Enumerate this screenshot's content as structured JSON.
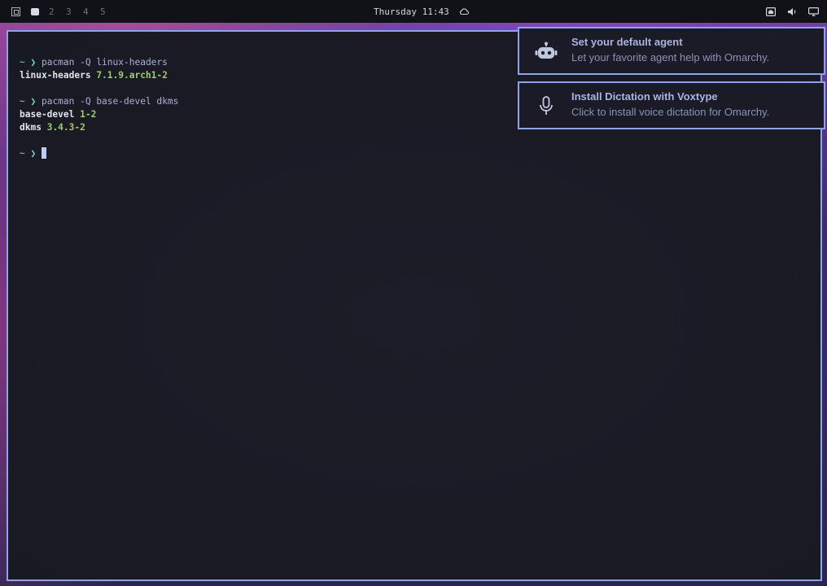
{
  "topbar": {
    "workspaces": [
      "2",
      "3",
      "4",
      "5"
    ],
    "clock": "Thursday 11:43",
    "icons": [
      "apps-icon",
      "weather-cloud-icon",
      "network-icon",
      "volume-icon",
      "display-icon"
    ]
  },
  "terminal": {
    "prompt": "~ ❯",
    "lines": [
      {
        "command": "pacman -Q linux-headers"
      },
      {
        "package": "linux-headers",
        "version": "7.1.9.arch1-2"
      },
      {
        "command": "pacman -Q base-devel dkms"
      },
      {
        "package": "base-devel",
        "version": "1-2"
      },
      {
        "package": "dkms",
        "version": "3.4.3-2"
      }
    ]
  },
  "notifications": [
    {
      "icon": "robot-icon",
      "title": "Set your default agent",
      "body": "Let your favorite agent help with Omarchy."
    },
    {
      "icon": "microphone-icon",
      "title": "Install Dictation with Voxtype",
      "body": "Click to install voice dictation for Omarchy."
    }
  ],
  "colors": {
    "accent_border": "#8fa4e8",
    "terminal_bg": "#1a1b26",
    "version_green": "#9ece6a",
    "prompt_cyan": "#73daca"
  }
}
